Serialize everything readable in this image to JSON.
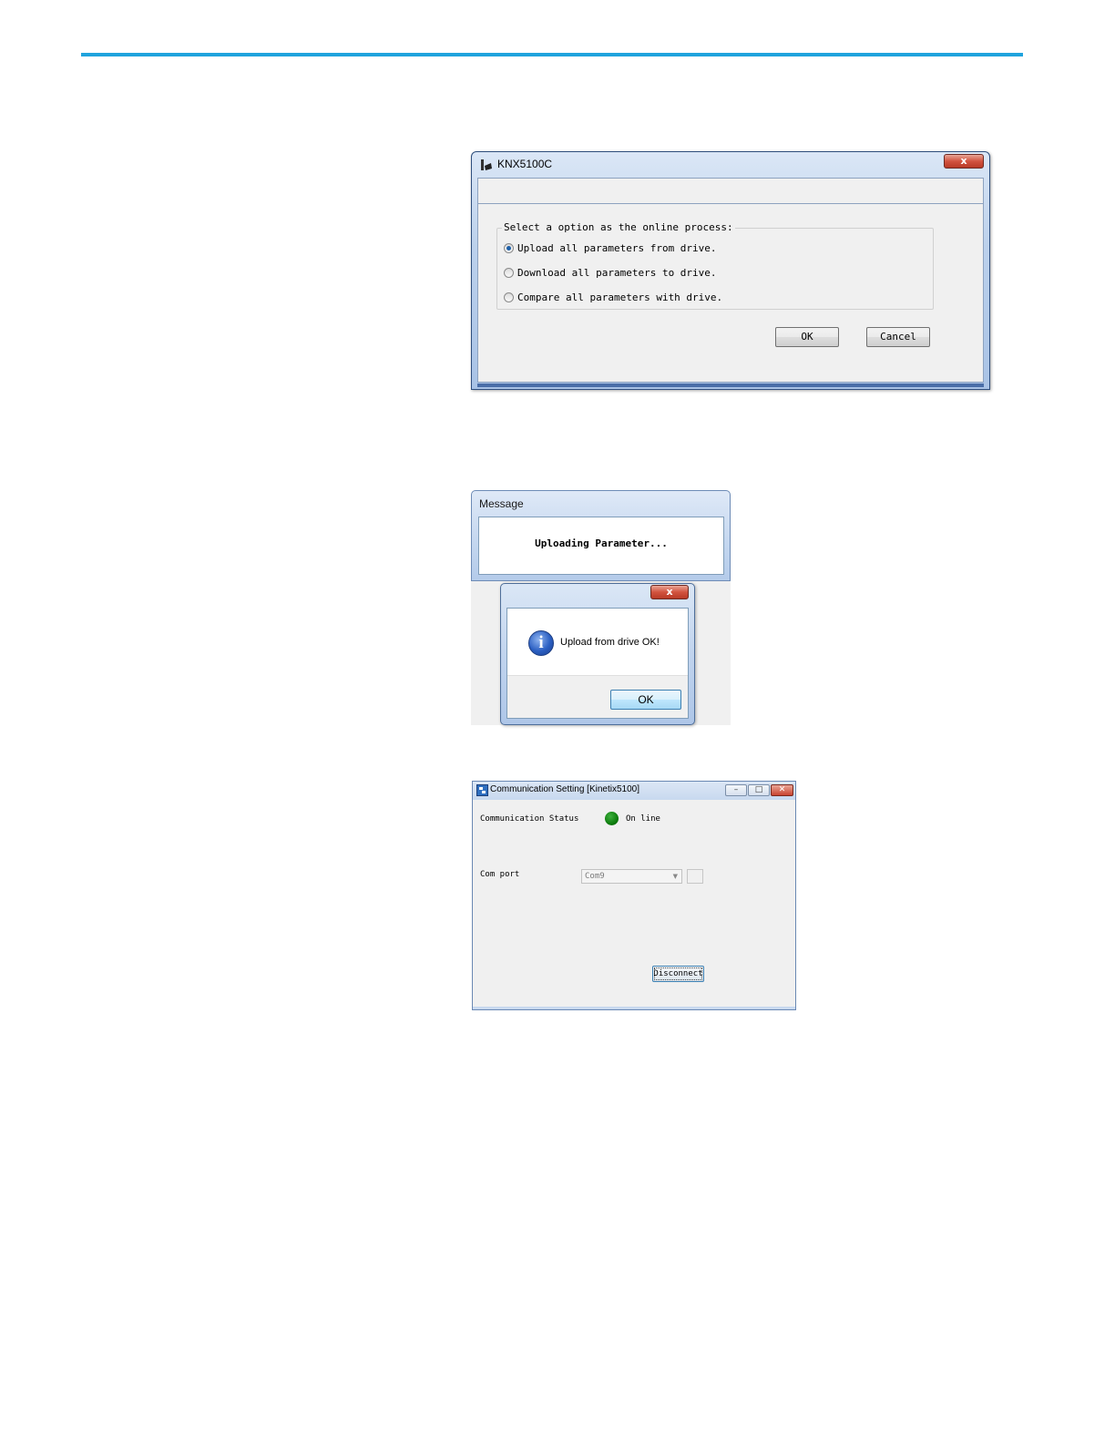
{
  "dialog_knx": {
    "title": "KNX5100C",
    "close_label": "x",
    "group_label": "Select a option as the online process:",
    "options": [
      {
        "label": "Upload all parameters from drive.",
        "selected": true
      },
      {
        "label": "Download all parameters to drive.",
        "selected": false
      },
      {
        "label": "Compare all parameters with drive.",
        "selected": false
      }
    ],
    "ok_label": "OK",
    "cancel_label": "Cancel"
  },
  "message_window": {
    "title": "Message",
    "text": "Uploading Parameter..."
  },
  "info_dialog": {
    "close_label": "x",
    "icon": "info-icon",
    "icon_glyph": "i",
    "text": "Upload from drive OK!",
    "ok_label": "OK"
  },
  "comm_setting": {
    "title": "Communication Setting [Kinetix5100]",
    "status_label": "Communication Status",
    "status_text": "On line",
    "status_color": "#0d7d0d",
    "com_port_label": "Com port",
    "com_port_value": "Com9",
    "disconnect_label": "Disconnect"
  },
  "colors": {
    "top_rule": "#1fa3dd"
  }
}
